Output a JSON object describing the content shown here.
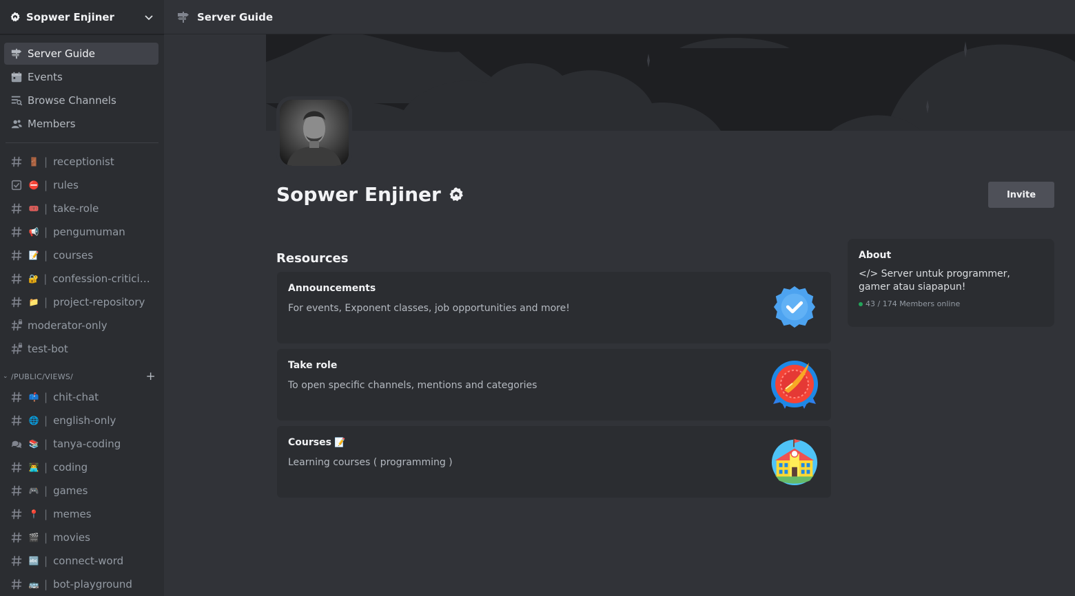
{
  "server": {
    "name": "Sopwer Enjiner"
  },
  "nav": [
    {
      "label": "Server Guide",
      "icon": "signpost-icon",
      "active": true
    },
    {
      "label": "Events",
      "icon": "calendar-icon"
    },
    {
      "label": "Browse Channels",
      "icon": "browse-channels-icon"
    },
    {
      "label": "Members",
      "icon": "members-icon"
    }
  ],
  "channels": [
    {
      "icon": "hash-icon",
      "emoji": "🚪",
      "label": "receptionist"
    },
    {
      "icon": "rules-icon",
      "emoji": "⛔",
      "label": "rules"
    },
    {
      "icon": "hash-icon",
      "emoji": "🎟️",
      "label": "take-role"
    },
    {
      "icon": "hash-icon",
      "emoji": "📢",
      "label": "pengumuman"
    },
    {
      "icon": "hash-icon",
      "emoji": "📝",
      "label": "courses"
    },
    {
      "icon": "hash-icon",
      "emoji": "🔐",
      "label": "confession-criticis..."
    },
    {
      "icon": "hash-icon",
      "emoji": "📁",
      "label": "project-repository"
    },
    {
      "icon": "hash-locked-icon",
      "label": "moderator-only"
    },
    {
      "icon": "hash-locked-icon",
      "label": "test-bot"
    }
  ],
  "category": {
    "name": "/PUBLIC/VIEWS/"
  },
  "category_channels": [
    {
      "icon": "hash-icon",
      "emoji": "📫",
      "label": "chit-chat"
    },
    {
      "icon": "hash-icon",
      "emoji": "🌐",
      "label": "english-only"
    },
    {
      "icon": "forum-icon",
      "emoji": "📚",
      "label": "tanya-coding"
    },
    {
      "icon": "hash-icon",
      "emoji": "👨‍💻",
      "label": "coding"
    },
    {
      "icon": "hash-icon",
      "emoji": "🎮",
      "label": "games"
    },
    {
      "icon": "hash-icon",
      "emoji": "📍",
      "label": "memes"
    },
    {
      "icon": "hash-icon",
      "emoji": "🎬",
      "label": "movies"
    },
    {
      "icon": "hash-icon",
      "emoji": "🔤",
      "label": "connect-word"
    },
    {
      "icon": "hash-icon",
      "emoji": "🚌",
      "label": "bot-playground"
    }
  ],
  "topbar": {
    "title": "Server Guide"
  },
  "main": {
    "title": "Sopwer Enjiner",
    "invite_label": "Invite",
    "resources_title": "Resources"
  },
  "resources": [
    {
      "title": "Announcements",
      "desc": "For events, Exponent classes, job opportunities and more!",
      "icon": "verified-badge-icon"
    },
    {
      "title": "Take role",
      "desc": "To open specific channels, mentions and categories",
      "icon": "role-medal-icon"
    },
    {
      "title": "Courses",
      "title_emoji": "📝",
      "desc": "Learning courses ( programming )",
      "icon": "school-building-icon"
    }
  ],
  "about": {
    "title": "About",
    "desc": "</> Server untuk programmer, gamer atau siapapun!",
    "online": "43 / 174 Members online"
  },
  "colors": {
    "background": "#313338",
    "sidebar": "#2b2d31",
    "active_item": "#404249",
    "online_green": "#23a55a",
    "button_gray": "#4e5058"
  }
}
